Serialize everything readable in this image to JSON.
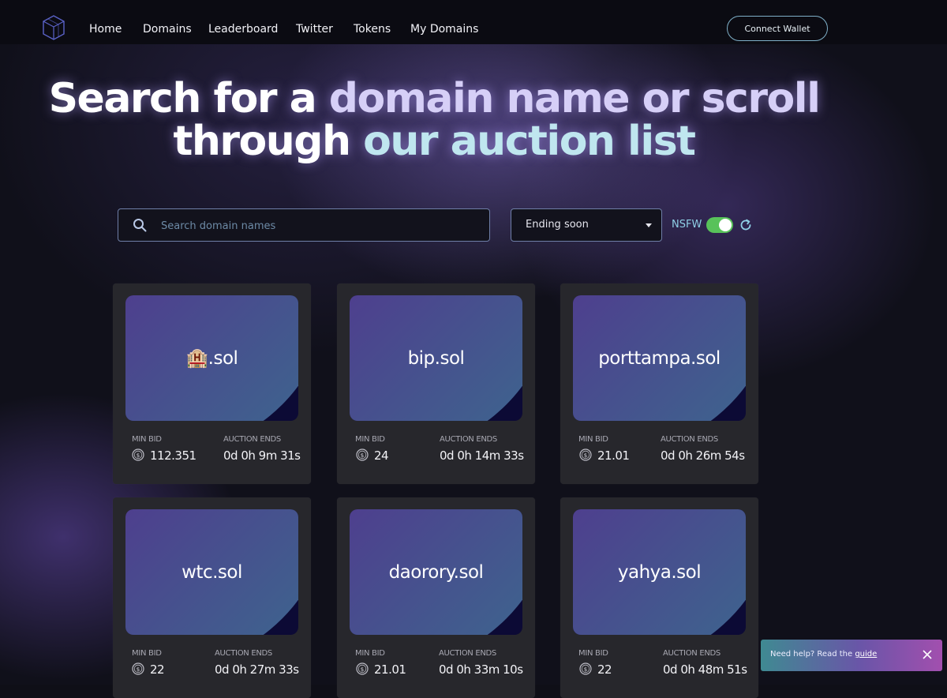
{
  "nav": {
    "links": [
      "Home",
      "Domains",
      "Leaderboard",
      "Twitter",
      "Tokens",
      "My Domains"
    ],
    "connect_label": "Connect Wallet"
  },
  "hero": {
    "line1_white": "Search for a ",
    "line1_accent": "domain name or scroll",
    "line2_white": "through ",
    "line2_accent": "our auction list"
  },
  "search": {
    "placeholder": "Search domain names",
    "value": ""
  },
  "sort": {
    "selected": "Ending soon"
  },
  "nsfw": {
    "label": "NSFW",
    "on": true
  },
  "labels": {
    "min_bid": "MIN BID",
    "auction_ends": "AUCTION ENDS"
  },
  "cards": [
    {
      "name": "🏨.sol",
      "min_bid": "112.351",
      "ends": "0d 0h 9m 31s"
    },
    {
      "name": "bip.sol",
      "min_bid": "24",
      "ends": "0d 0h 14m 33s"
    },
    {
      "name": "porttampa.sol",
      "min_bid": "21.01",
      "ends": "0d 0h 26m 54s"
    },
    {
      "name": "wtc.sol",
      "min_bid": "22",
      "ends": "0d 0h 27m 33s"
    },
    {
      "name": "daorory.sol",
      "min_bid": "21.01",
      "ends": "0d 0h 33m 10s"
    },
    {
      "name": "yahya.sol",
      "min_bid": "22",
      "ends": "0d 0h 48m 51s"
    }
  ],
  "help": {
    "text": "Need help? Read the ",
    "link": "guide"
  },
  "icons": {
    "logo": "cube-logo-icon",
    "search": "search-icon",
    "refresh": "refresh-icon",
    "coin": "coin-icon",
    "close": "close-icon"
  },
  "colors": {
    "accent_toggle": "#58c25a",
    "nsfw_label": "#8fd0e6",
    "button_border": "#7fb0c8"
  }
}
